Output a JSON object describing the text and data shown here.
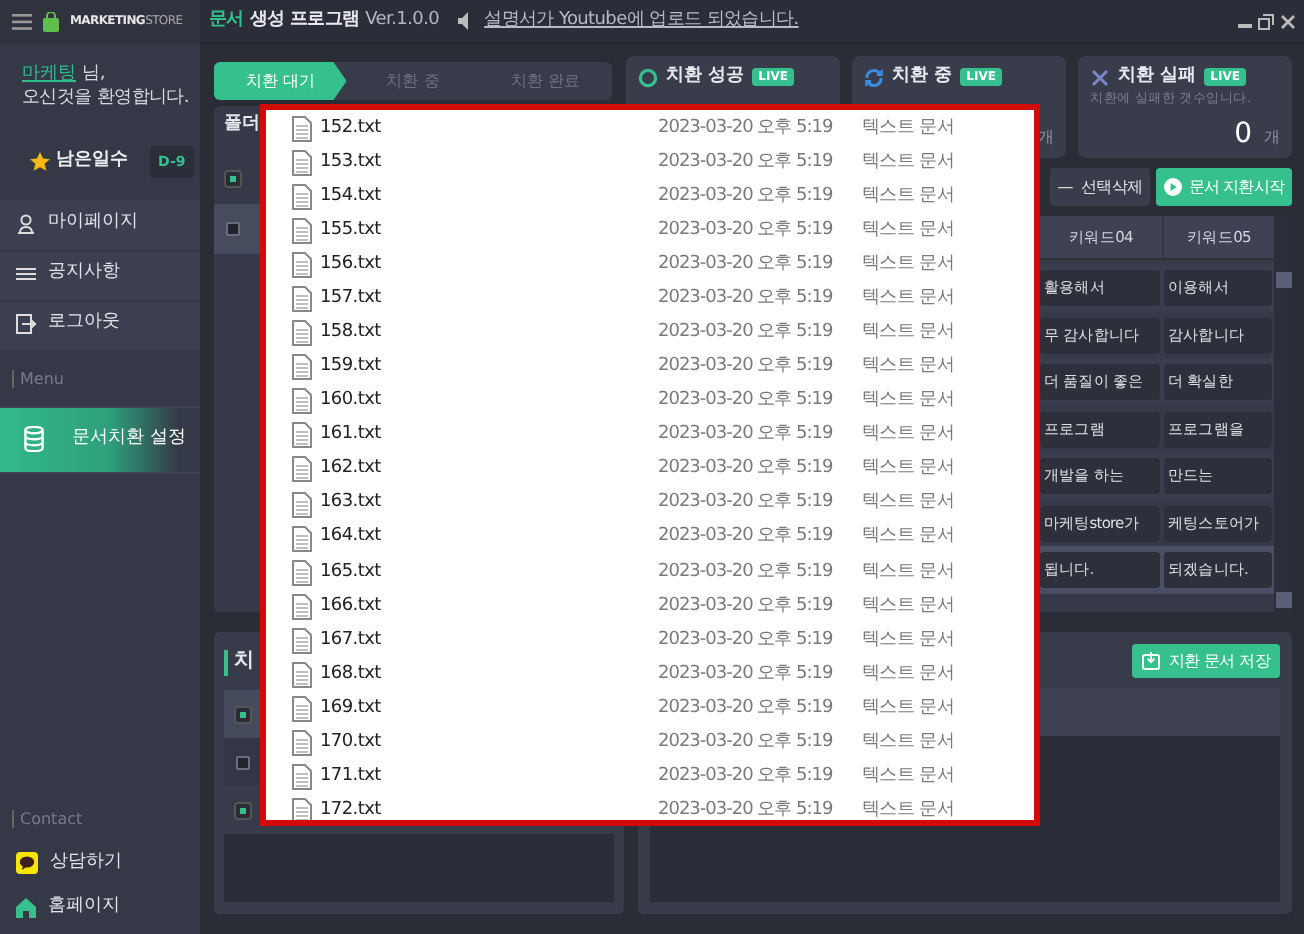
{
  "title_bar": {
    "app_name": "MARKETING",
    "app_name_light": "STORE",
    "title_accent": "문서",
    "title": "생성 프로그램",
    "version": "Ver.1.0.0",
    "notice": "설명서가 Youtube에 업로드 되었습니다."
  },
  "sidebar": {
    "user": "마케팅",
    "user_suffix": "님,",
    "welcome": "오신것을 환영합니다.",
    "days_label": "남은일수",
    "days_badge": "D-9",
    "items": [
      {
        "label": "마이페이지"
      },
      {
        "label": "공지사항"
      },
      {
        "label": "로그아웃"
      }
    ],
    "menu_heading": "Menu",
    "menu_items": [
      {
        "label": "문서치환 설정",
        "selected": true
      }
    ],
    "contact_heading": "Contact",
    "contact_items": [
      {
        "label": "상담하기"
      },
      {
        "label": "홈페이지"
      }
    ]
  },
  "steps": [
    {
      "label": "치환 대기",
      "selected": true
    },
    {
      "label": "치환 중",
      "selected": false
    },
    {
      "label": "치환 완료",
      "selected": false
    }
  ],
  "stats": [
    {
      "kind": "success",
      "title": "치환 성공",
      "badge": "LIVE"
    },
    {
      "kind": "progress",
      "title": "치환 중",
      "badge": "LIVE",
      "unit": "개"
    },
    {
      "kind": "fail",
      "title": "치환 실패",
      "badge": "LIVE",
      "subtitle": "치환에 실패한 갯수입니다.",
      "value": "0",
      "unit": "개"
    }
  ],
  "folder_panel": {
    "title": "폴더",
    "rows": [
      {
        "checked": true,
        "selected": false
      },
      {
        "checked": false,
        "selected": true
      }
    ]
  },
  "keyword_table": {
    "delete_icon": "—",
    "delete_button": "선택삭제",
    "start_button": "문서 지환시작",
    "columns": [
      "키워드04",
      "키워드05"
    ],
    "rows": [
      {
        "cells": [
          "활용해서",
          "이용해서"
        ],
        "selected": false
      },
      {
        "cells": [
          "무 감사합니다",
          "감사합니다"
        ],
        "selected": false
      },
      {
        "cells": [
          "더 품질이 좋은",
          "더 확실한"
        ],
        "selected": false
      },
      {
        "cells": [
          "프로그램",
          "프로그램을"
        ],
        "selected": false
      },
      {
        "cells": [
          "개발을 하는",
          "만드는"
        ],
        "selected": false
      },
      {
        "cells": [
          "마케팅store가",
          "케팅스토어가"
        ],
        "selected": false
      },
      {
        "cells": [
          "됩니다.",
          "되겠습니다."
        ],
        "selected": true
      }
    ]
  },
  "result_panel": {
    "title": "치",
    "rows": [
      {
        "checked": true,
        "selected": true
      },
      {
        "checked": false,
        "selected": false
      },
      {
        "checked": true,
        "selected": false
      }
    ]
  },
  "save_panel": {
    "save_button": "지환 문서 저장"
  },
  "file_list": [
    {
      "name": "152.txt",
      "date": "2023-03-20 오후 5:19",
      "type": "텍스트 문서"
    },
    {
      "name": "153.txt",
      "date": "2023-03-20 오후 5:19",
      "type": "텍스트 문서"
    },
    {
      "name": "154.txt",
      "date": "2023-03-20 오후 5:19",
      "type": "텍스트 문서"
    },
    {
      "name": "155.txt",
      "date": "2023-03-20 오후 5:19",
      "type": "텍스트 문서"
    },
    {
      "name": "156.txt",
      "date": "2023-03-20 오후 5:19",
      "type": "텍스트 문서"
    },
    {
      "name": "157.txt",
      "date": "2023-03-20 오후 5:19",
      "type": "텍스트 문서"
    },
    {
      "name": "158.txt",
      "date": "2023-03-20 오후 5:19",
      "type": "텍스트 문서"
    },
    {
      "name": "159.txt",
      "date": "2023-03-20 오후 5:19",
      "type": "텍스트 문서"
    },
    {
      "name": "160.txt",
      "date": "2023-03-20 오후 5:19",
      "type": "텍스트 문서"
    },
    {
      "name": "161.txt",
      "date": "2023-03-20 오후 5:19",
      "type": "텍스트 문서"
    },
    {
      "name": "162.txt",
      "date": "2023-03-20 오후 5:19",
      "type": "텍스트 문서"
    },
    {
      "name": "163.txt",
      "date": "2023-03-20 오후 5:19",
      "type": "텍스트 문서"
    },
    {
      "name": "164.txt",
      "date": "2023-03-20 오후 5:19",
      "type": "텍스트 문서"
    },
    {
      "name": "165.txt",
      "date": "2023-03-20 오후 5:19",
      "type": "텍스트 문서"
    },
    {
      "name": "166.txt",
      "date": "2023-03-20 오후 5:19",
      "type": "텍스트 문서"
    },
    {
      "name": "167.txt",
      "date": "2023-03-20 오후 5:19",
      "type": "텍스트 문서"
    },
    {
      "name": "168.txt",
      "date": "2023-03-20 오후 5:19",
      "type": "텍스트 문서"
    },
    {
      "name": "169.txt",
      "date": "2023-03-20 오후 5:19",
      "type": "텍스트 문서"
    },
    {
      "name": "170.txt",
      "date": "2023-03-20 오후 5:19",
      "type": "텍스트 문서"
    },
    {
      "name": "171.txt",
      "date": "2023-03-20 오후 5:19",
      "type": "텍스트 문서"
    },
    {
      "name": "172.txt",
      "date": "2023-03-20 오후 5:19",
      "type": "텍스트 문서"
    }
  ]
}
